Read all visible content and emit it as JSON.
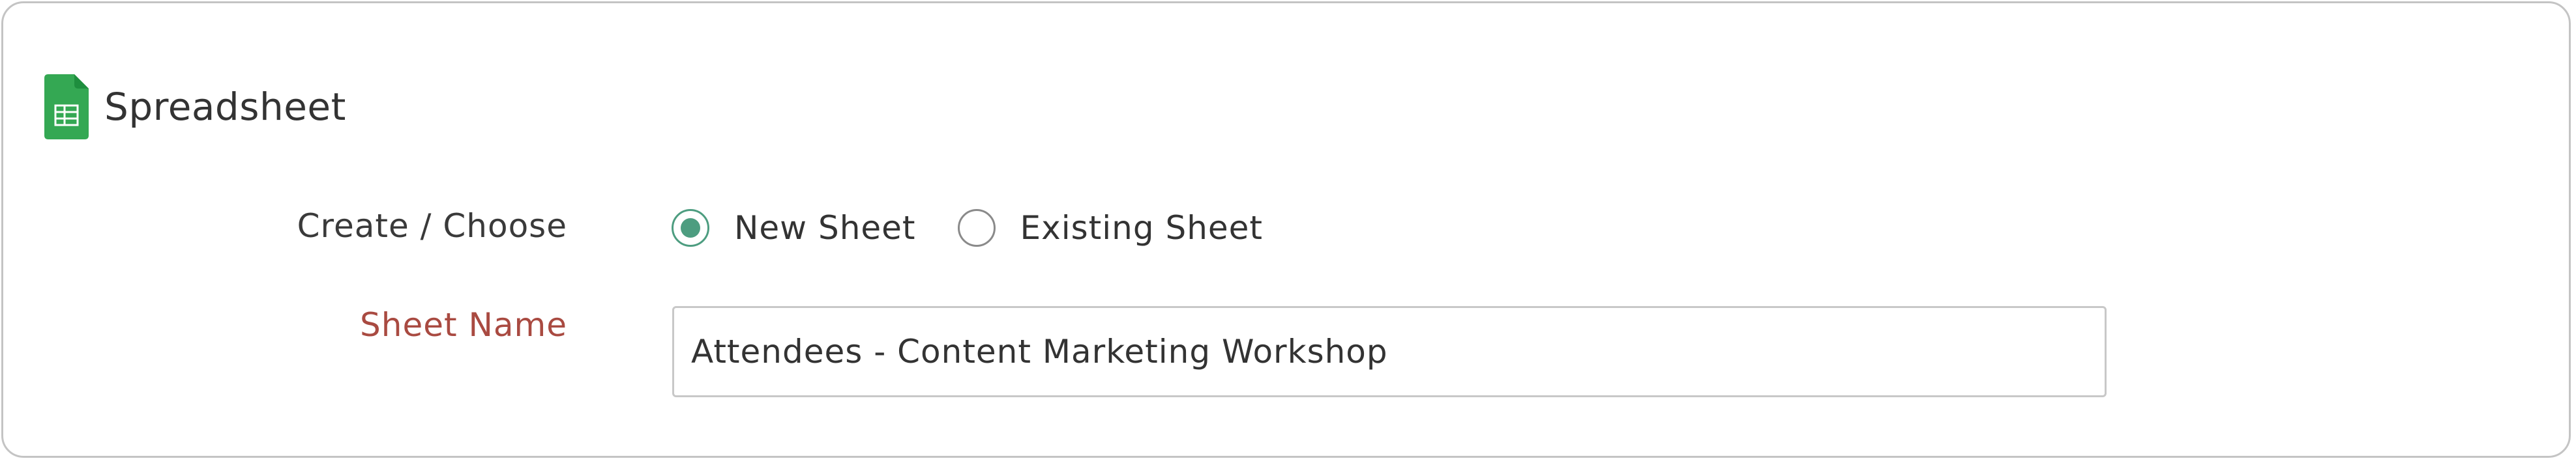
{
  "section": {
    "title": "Spreadsheet",
    "icon": "google-sheets-icon",
    "icon_color": "#34a853"
  },
  "create_choose": {
    "label": "Create / Choose",
    "options": [
      {
        "label": "New Sheet",
        "checked": true
      },
      {
        "label": "Existing Sheet",
        "checked": false
      }
    ],
    "accent_color": "#4d9d80"
  },
  "sheet_name": {
    "label": "Sheet Name",
    "required_color": "#a94a41",
    "value": "Attendees - Content Marketing Workshop"
  }
}
